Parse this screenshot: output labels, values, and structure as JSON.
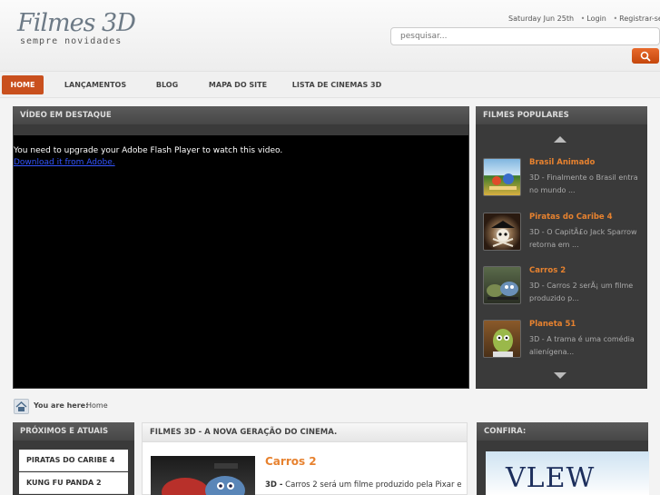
{
  "header": {
    "logo_title": "Filmes 3D",
    "logo_subtitle": "sempre novidades",
    "date": "Saturday Jun 25th",
    "login": "Login",
    "register": "Registrar-se",
    "search_placeholder": "pesquisar..."
  },
  "nav": {
    "items": [
      {
        "label": "HOME",
        "active": true
      },
      {
        "label": "LANÇAMENTOS"
      },
      {
        "label": "BLOG"
      },
      {
        "label": "MAPA DO SITE"
      },
      {
        "label": "LISTA DE CINEMAS 3D"
      }
    ]
  },
  "featured": {
    "title": "VÍDEO EM DESTAQUE",
    "message": "You need to upgrade your Adobe Flash Player to watch this video.",
    "link": "Download it from Adobe."
  },
  "popular": {
    "title": "FILMES POPULARES",
    "items": [
      {
        "title": "Brasil Animado",
        "desc": "3D - Finalmente o Brasil entra no mundo ..."
      },
      {
        "title": "Piratas do Caribe 4",
        "desc": "3D - O CapitÃ£o Jack Sparrow retorna em ..."
      },
      {
        "title": "Carros 2",
        "desc": "3D - Carros 2 serÃ¡ um filme produzido p..."
      },
      {
        "title": "Planeta 51",
        "desc": "3D - A trama é uma comédia alienígena..."
      }
    ]
  },
  "breadcrumb": {
    "label": "You are here:",
    "current": "Home"
  },
  "upcoming": {
    "title": "PRÓXIMOS E ATUAIS",
    "items": [
      "PIRATAS DO CARIBE 4",
      "KUNG FU PANDA 2"
    ]
  },
  "main_article": {
    "section_title": "FILMES 3D - A NOVA GERAÇÃO DO CINEMA.",
    "title": "Carros 2",
    "lead": "3D -",
    "text": "Carros 2 será um filme produzido pela Pixar e"
  },
  "sidebar_right": {
    "title": "CONFIRA:",
    "ad_text": "VLEW"
  },
  "colors": {
    "accent": "#e7822f",
    "nav_active": "#c9501e",
    "panel_dark": "#3a3a3a"
  }
}
